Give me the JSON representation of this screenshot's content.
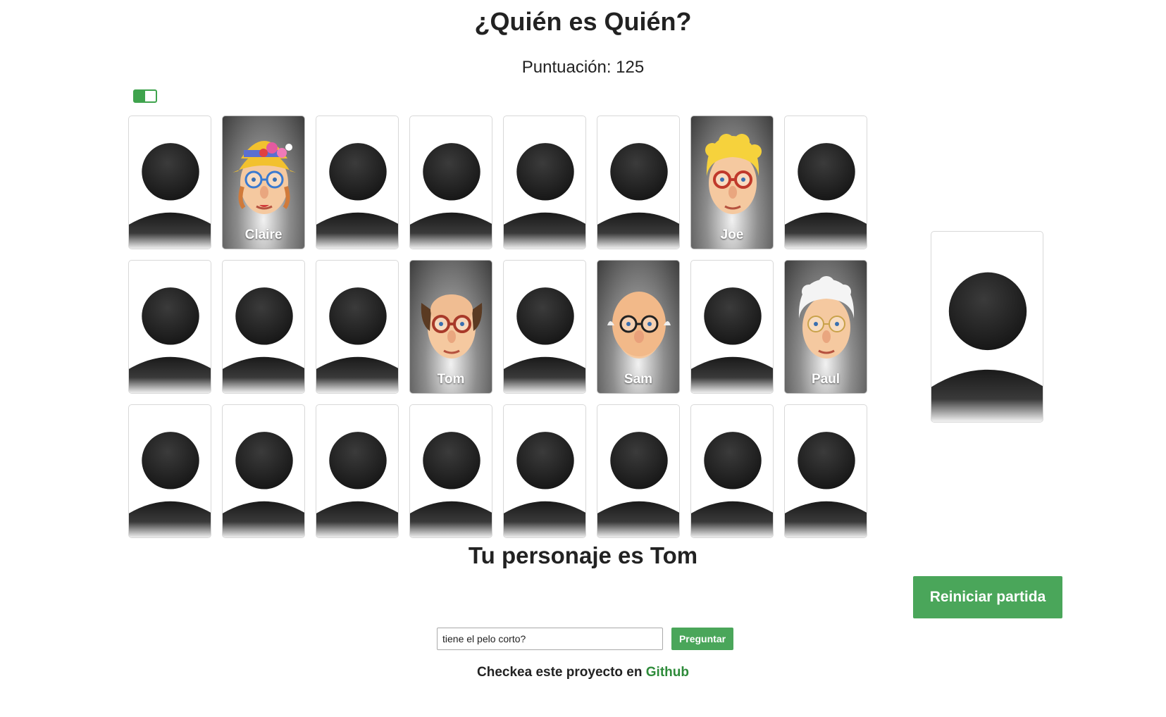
{
  "header": {
    "title": "¿Quién es Quién?",
    "score_text": "Puntuación: 125"
  },
  "toggle": {
    "state": "on",
    "accent_color": "#3fa34d"
  },
  "board": {
    "columns": 8,
    "rows": 3,
    "cards": [
      {
        "status": "hidden"
      },
      {
        "status": "revealed",
        "name": "Claire",
        "face": "claire"
      },
      {
        "status": "hidden"
      },
      {
        "status": "hidden"
      },
      {
        "status": "hidden"
      },
      {
        "status": "hidden"
      },
      {
        "status": "revealed",
        "name": "Joe",
        "face": "joe"
      },
      {
        "status": "hidden"
      },
      {
        "status": "hidden"
      },
      {
        "status": "hidden"
      },
      {
        "status": "hidden"
      },
      {
        "status": "revealed",
        "name": "Tom",
        "face": "tom"
      },
      {
        "status": "hidden"
      },
      {
        "status": "revealed",
        "name": "Sam",
        "face": "sam"
      },
      {
        "status": "hidden"
      },
      {
        "status": "revealed",
        "name": "Paul",
        "face": "paul"
      },
      {
        "status": "hidden"
      },
      {
        "status": "hidden"
      },
      {
        "status": "hidden"
      },
      {
        "status": "hidden"
      },
      {
        "status": "hidden"
      },
      {
        "status": "hidden"
      },
      {
        "status": "hidden"
      },
      {
        "status": "hidden"
      }
    ]
  },
  "secret_card": {
    "status": "hidden"
  },
  "result": {
    "text": "Tu personaje es Tom"
  },
  "controls": {
    "reset_label": "Reiniciar partida",
    "question_value": "tiene el pelo corto?",
    "ask_label": "Preguntar",
    "button_color": "#4aa65a"
  },
  "footer": {
    "text": "Checkea este proyecto en",
    "link_text": "Github"
  }
}
